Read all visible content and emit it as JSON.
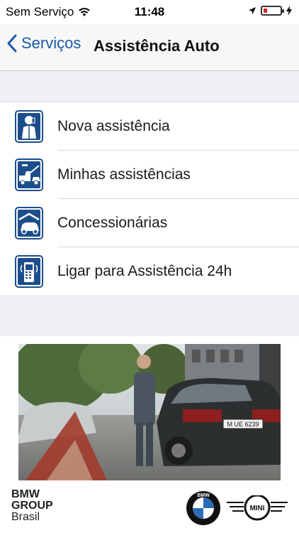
{
  "status_bar": {
    "carrier": "Sem Serviço",
    "time": "11:48"
  },
  "navbar": {
    "back_label": "Serviços",
    "title": "Assistência Auto"
  },
  "menu": {
    "items": [
      {
        "label": "Nova assistência",
        "icon": "person-phone-icon"
      },
      {
        "label": "Minhas assistências",
        "icon": "tow-truck-icon"
      },
      {
        "label": "Concessionárias",
        "icon": "car-dealer-icon"
      },
      {
        "label": "Ligar para Assistência 24h",
        "icon": "mobile-phone-icon"
      }
    ]
  },
  "promo_image": {
    "license_plate": "M UE 6239"
  },
  "footer": {
    "group_line1": "BMW",
    "group_line2": "GROUP",
    "group_line3": "Brasil",
    "bmw_logo_letters": "BMW",
    "mini_logo_text": "MINI"
  },
  "colors": {
    "accent": "#1a5ba8",
    "icon_blue": "#1d4e8c",
    "group_bg": "#efeff4"
  }
}
